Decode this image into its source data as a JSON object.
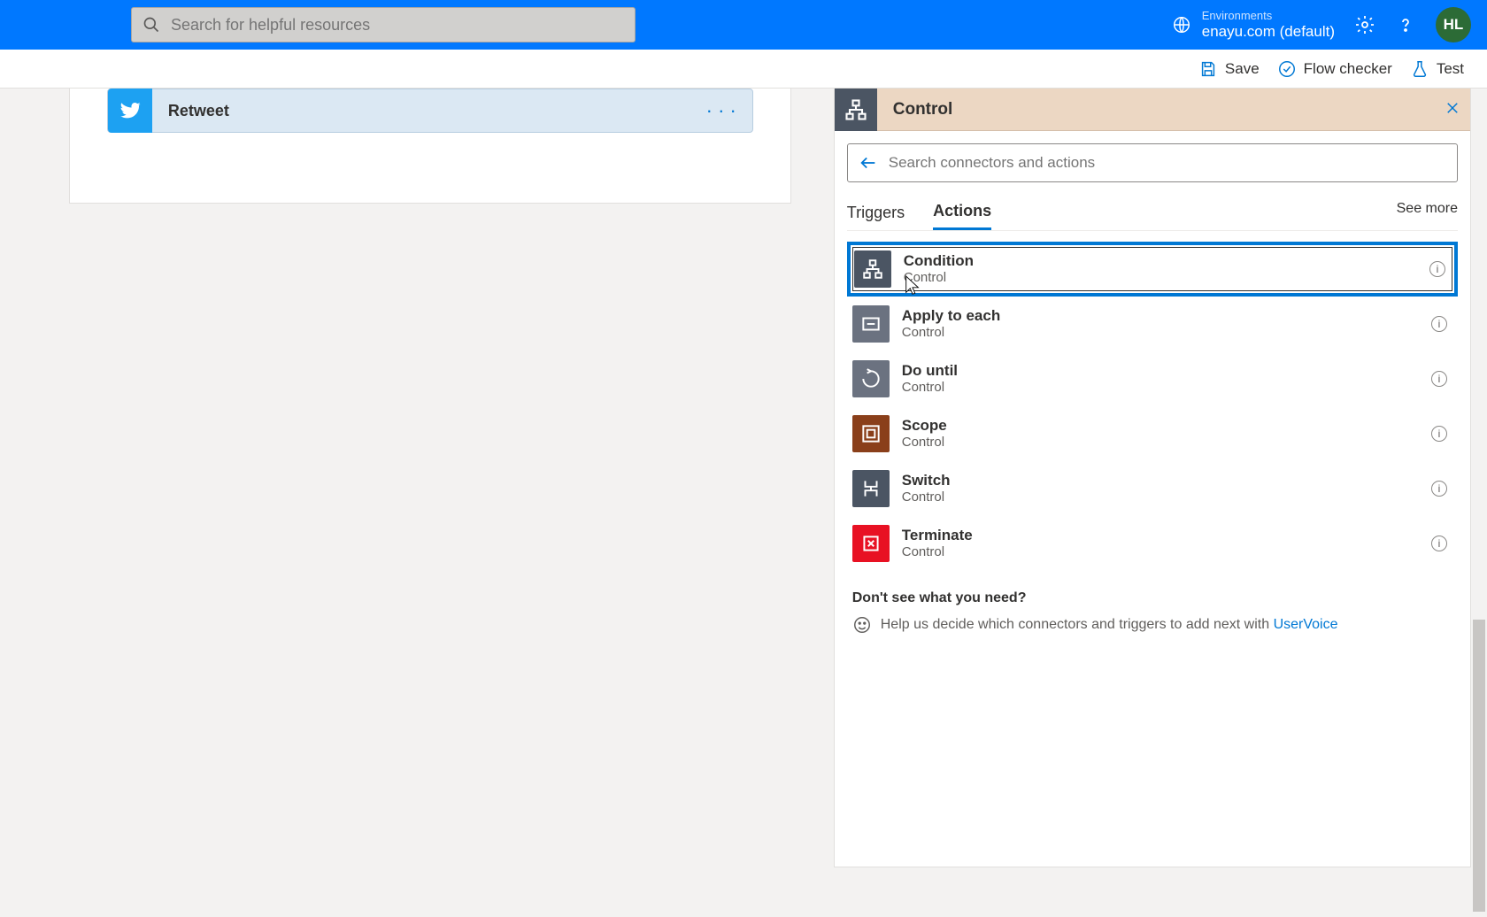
{
  "topbar": {
    "search_placeholder": "Search for helpful resources",
    "env_label": "Environments",
    "env_name": "enayu.com (default)",
    "avatar_initials": "HL"
  },
  "commandbar": {
    "save": "Save",
    "checker": "Flow checker",
    "test": "Test"
  },
  "left_card": {
    "title": "Retweet",
    "menu": "· · ·"
  },
  "control_panel": {
    "header_title": "Control",
    "search_placeholder": "Search connectors and actions",
    "tabs": {
      "triggers": "Triggers",
      "actions": "Actions",
      "see_more": "See more"
    },
    "active_tab": "actions",
    "actions": [
      {
        "name": "Condition",
        "sub": "Control",
        "color": "#4b5563",
        "selected": true,
        "icon": "branch"
      },
      {
        "name": "Apply to each",
        "sub": "Control",
        "color": "#6b7280",
        "selected": false,
        "icon": "loop-each"
      },
      {
        "name": "Do until",
        "sub": "Control",
        "color": "#6b7280",
        "selected": false,
        "icon": "loop-until"
      },
      {
        "name": "Scope",
        "sub": "Control",
        "color": "#8a3f1a",
        "selected": false,
        "icon": "scope"
      },
      {
        "name": "Switch",
        "sub": "Control",
        "color": "#4b5563",
        "selected": false,
        "icon": "switch"
      },
      {
        "name": "Terminate",
        "sub": "Control",
        "color": "#e81123",
        "selected": false,
        "icon": "terminate"
      }
    ],
    "need": {
      "title": "Don't see what you need?",
      "text_prefix": "Help us decide which connectors and triggers to add next with ",
      "link_text": "UserVoice"
    }
  }
}
